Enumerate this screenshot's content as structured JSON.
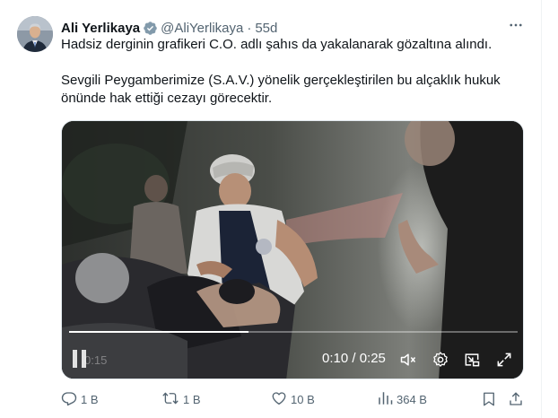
{
  "post": {
    "author_name": "Ali Yerlikaya",
    "author_handle": "@AliYerlikaya",
    "separator": "·",
    "time": "55d",
    "paragraphs": [
      "Hadsiz derginin grafikeri C.O. adlı şahıs da yakalanarak gözaltına alındı.",
      "Sevgili Peygamberimize (S.A.V.) yönelik gerçekleştirilen bu alçaklık hukuk önünde hak ettiği cezayı görecektir."
    ]
  },
  "video": {
    "timecode": "0:10 / 0:25",
    "ghost_time": "0:15",
    "progress": 0.4
  },
  "actions": {
    "replies": "1 B",
    "reposts": "1 B",
    "likes": "10 B",
    "views": "364 B"
  },
  "colors": {
    "text": "#0f1419",
    "secondary": "#536471",
    "verified": "#829aab"
  },
  "icons": {
    "more": "more-icon",
    "verified": "verified-badge-icon",
    "reply": "reply-icon",
    "repost": "repost-icon",
    "like": "like-icon",
    "views": "views-icon",
    "bookmark": "bookmark-icon",
    "share": "share-icon"
  }
}
